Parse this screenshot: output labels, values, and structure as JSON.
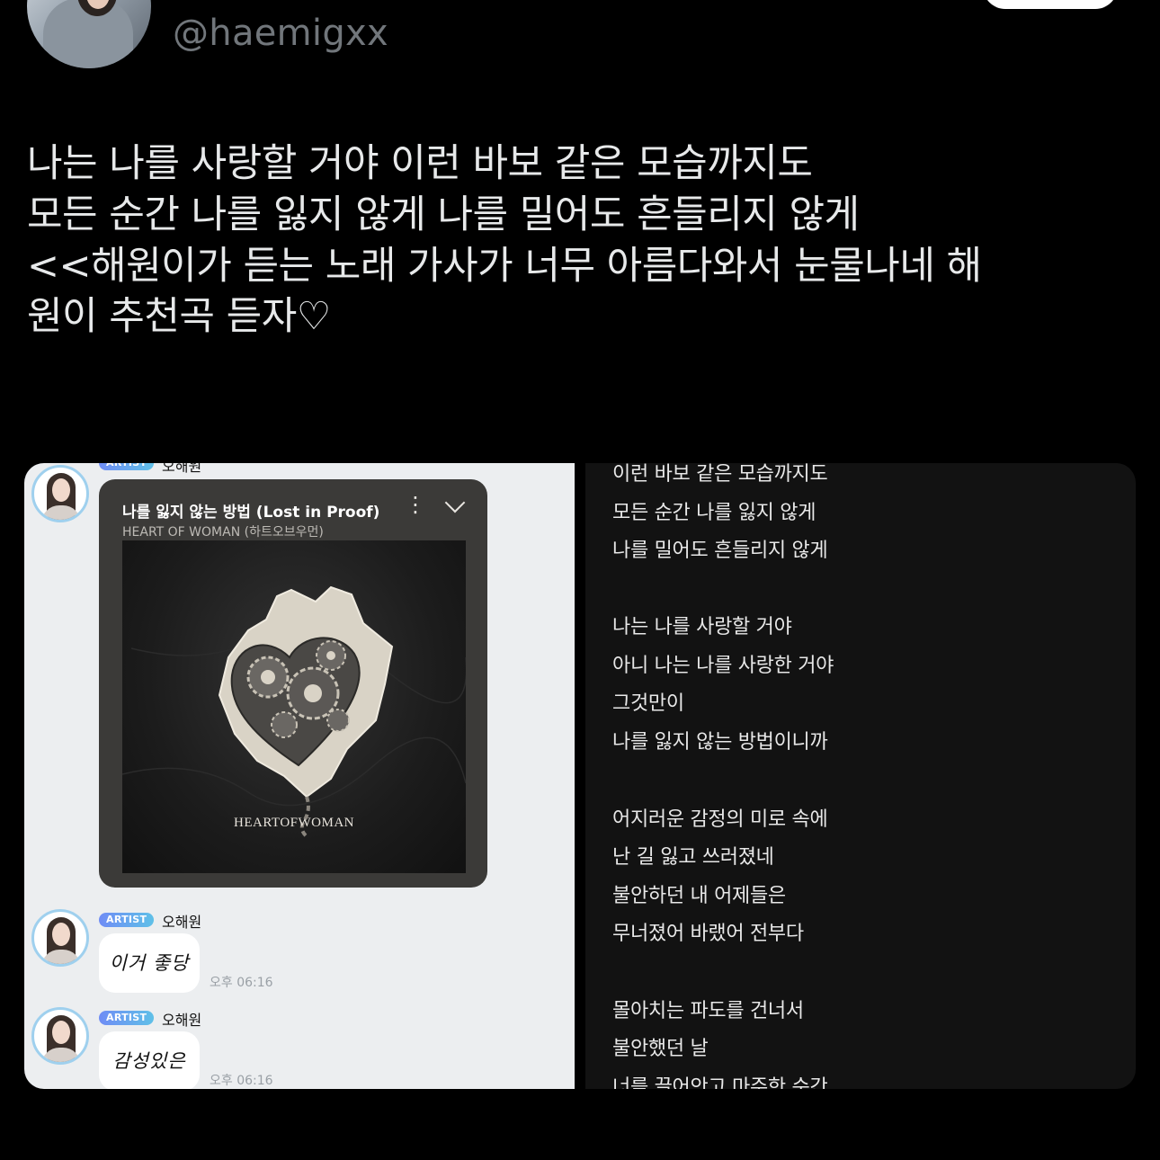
{
  "header": {
    "handle": "@haemigxx"
  },
  "tweet": {
    "lines": [
      "나는 나를 사랑할 거야 이런 바보 같은 모습까지도",
      "모든 순간 나를 잃지 않게 나를 밀어도 흔들리지 않게",
      "<<해원이가 듣는 노래 가사가 너무 아름다와서 눈물나네 해",
      "원이 추천곡 듣자♡"
    ]
  },
  "chat": {
    "top_name": "오해원",
    "music": {
      "title": "나를 잃지 않는 방법 (Lost in Proof)",
      "artist": "HEART OF WOMAN (하트오브우먼)",
      "album_text": "HEARTOFWOMAN"
    },
    "messages": [
      {
        "badge": "ARTIST",
        "name": "오해원",
        "text": "이거 좋당",
        "time": "오후 06:16"
      },
      {
        "badge": "ARTIST",
        "name": "오해원",
        "text": "감성있은",
        "time": "오후 06:16"
      }
    ]
  },
  "lyrics": [
    "이런 바보 같은 모습까지도",
    "모든 순간 나를 잃지 않게",
    "나를 밀어도 흔들리지 않게",
    "나는 나를 사랑할 거야",
    "아니 나는 나를 사랑한 거야",
    "그것만이",
    "나를 잃지 않는 방법이니까",
    "어지러운 감정의 미로 속에",
    "난 길 잃고 쓰러졌네",
    "불안하던 내 어제들은",
    "무너졌어 바랬어 전부다",
    "몰아치는 파도를 건너서",
    "불안했던 날",
    "너를 끌어안고 마주한 순간"
  ]
}
